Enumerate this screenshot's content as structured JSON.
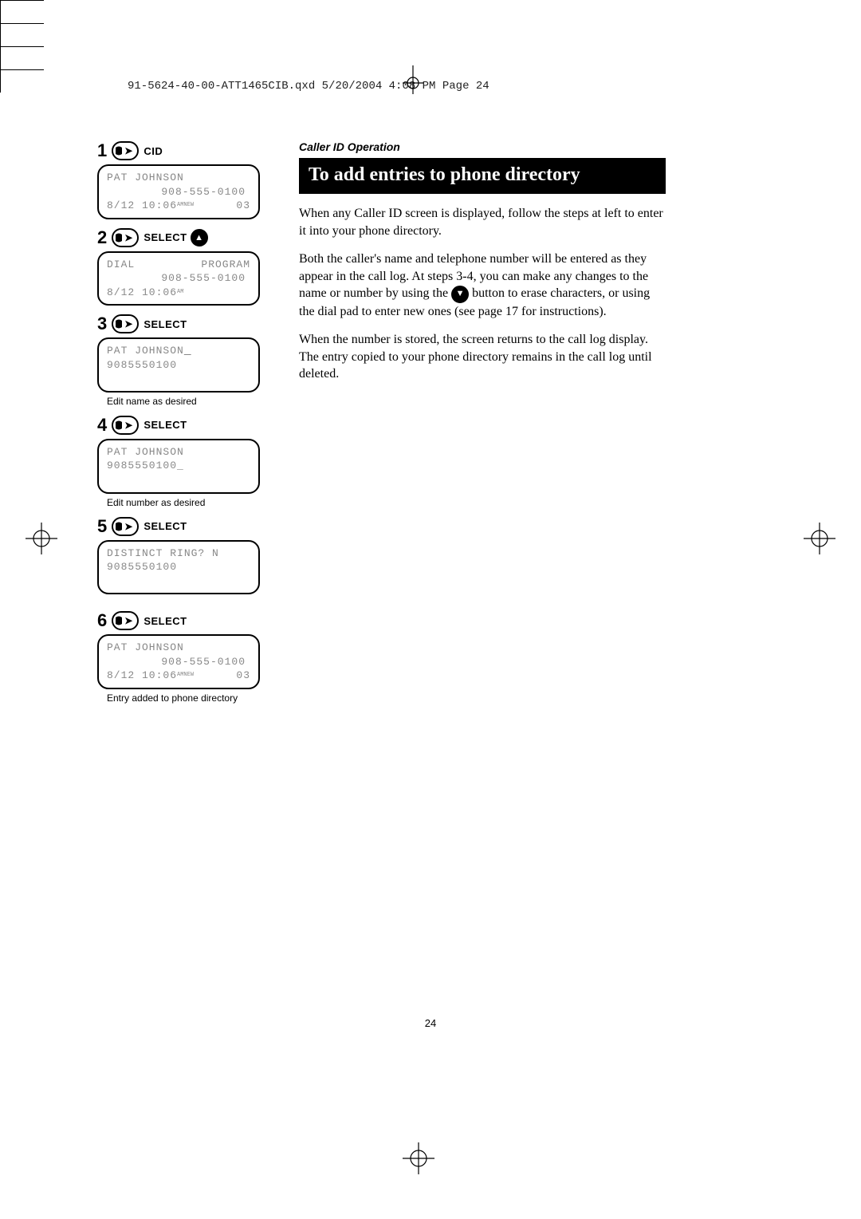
{
  "header_line": "91-5624-40-00-ATT1465CIB.qxd  5/20/2004  4:08 PM  Page 24",
  "section_label": "Caller ID Operation",
  "title": "To add entries to phone directory",
  "para1": "When any Caller ID screen is displayed, follow the steps at left to enter it into your phone directory.",
  "para2a": "Both the caller's name and telephone number will be entered as they appear in the call log. At steps 3-4, you can make any changes to the name or number by using the ",
  "para2b": " button to erase characters, or using the dial pad to enter new ones (see page 17 for instructions).",
  "para3": "When the number is stored, the screen returns to the call log display. The entry copied to your phone directory remains in the call log until deleted.",
  "page_number": "24",
  "steps": [
    {
      "num": "1",
      "label": "CID",
      "up_icon": false,
      "lcd": {
        "line1": "PAT JOHNSON",
        "line2": "908-555-0100",
        "line3_left": "8/12 10:06",
        "line3_right": "03",
        "am": "AM",
        "new": "NEW"
      },
      "caption": ""
    },
    {
      "num": "2",
      "label": "SELECT",
      "up_icon": true,
      "lcd": {
        "left": "DIAL",
        "right": "PROGRAM",
        "line2": "908-555-0100",
        "line3_left": "8/12 10:06",
        "am": "AM"
      },
      "caption": ""
    },
    {
      "num": "3",
      "label": "SELECT",
      "up_icon": false,
      "lcd": {
        "line1": "PAT JOHNSON",
        "line2": "9085550100"
      },
      "caption": "Edit name as desired",
      "underline_end": true
    },
    {
      "num": "4",
      "label": "SELECT",
      "up_icon": false,
      "lcd": {
        "line1": "PAT JOHNSON",
        "line2": "9085550100_"
      },
      "caption": "Edit number as desired"
    },
    {
      "num": "5",
      "label": "SELECT",
      "up_icon": false,
      "lcd": {
        "line1": "DISTINCT RING? N",
        "line2": "9085550100"
      },
      "caption": ""
    },
    {
      "num": "6",
      "label": "SELECT",
      "up_icon": false,
      "lcd": {
        "line1": "PAT JOHNSON",
        "line2": "908-555-0100",
        "line3_left": "8/12 10:06",
        "line3_right": "03",
        "am": "AM",
        "new": "NEW"
      },
      "caption": "Entry added to phone directory"
    }
  ]
}
